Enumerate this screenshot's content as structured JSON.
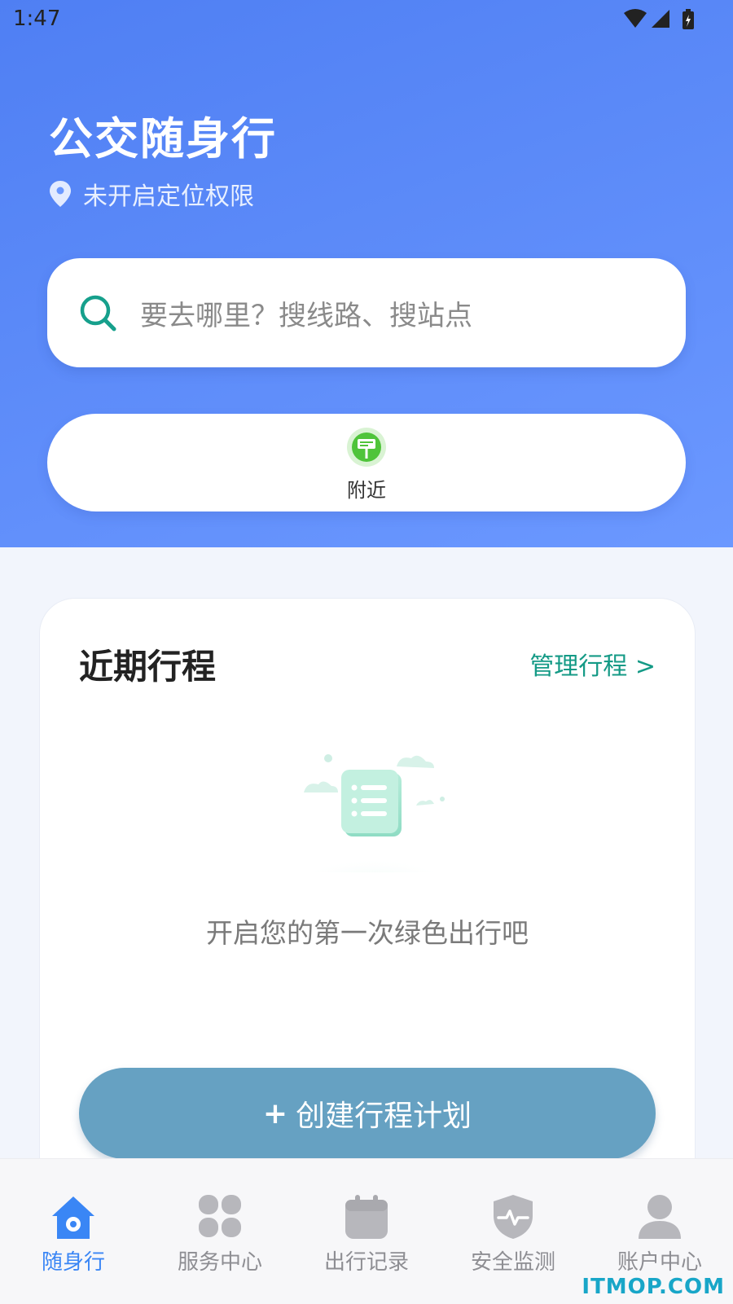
{
  "status_bar": {
    "time": "1:47"
  },
  "header": {
    "app_title": "公交随身行",
    "location_status": "未开启定位权限"
  },
  "search": {
    "placeholder": "要去哪里？搜线路、搜站点"
  },
  "quick_actions": [
    {
      "label": "附近",
      "icon": "bus-stop-sign-icon"
    }
  ],
  "trips": {
    "title": "近期行程",
    "manage_link": "管理行程 >",
    "empty_text": "开启您的第一次绿色出行吧",
    "create_button": "创建行程计划",
    "create_button_plus": "+"
  },
  "bottom_nav": {
    "active_color": "#3a86f5",
    "inactive_color": "#8e8e93",
    "items": [
      {
        "label": "随身行",
        "icon": "home-icon",
        "active": true
      },
      {
        "label": "服务中心",
        "icon": "grid-icon",
        "active": false
      },
      {
        "label": "出行记录",
        "icon": "calendar-icon",
        "active": false
      },
      {
        "label": "安全监测",
        "icon": "shield-pulse-icon",
        "active": false
      },
      {
        "label": "账户中心",
        "icon": "user-icon",
        "active": false
      }
    ]
  },
  "watermark": "ITMOP.COM"
}
